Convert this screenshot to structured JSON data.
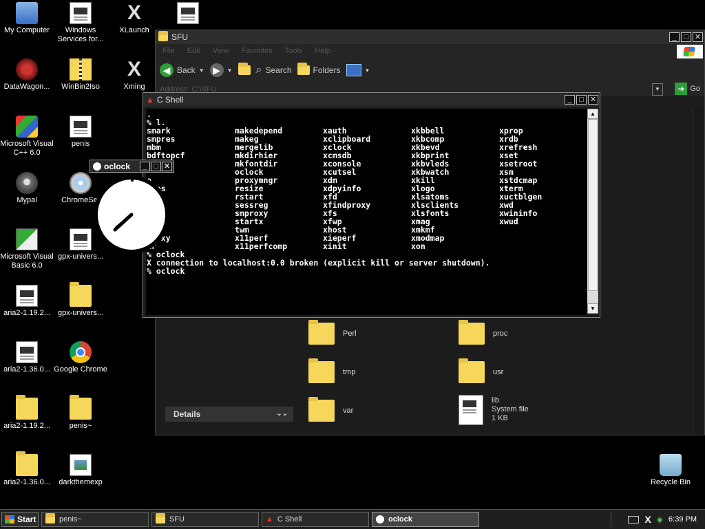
{
  "desktop": {
    "icons": [
      {
        "label": "My Computer",
        "icon": "computer-icon"
      },
      {
        "label": "Windows Services for...",
        "icon": "document-icon"
      },
      {
        "label": "XLaunch",
        "icon": "x-icon"
      },
      {
        "label": "",
        "icon": "document-icon"
      },
      {
        "label": "DataWagon...",
        "icon": "datawagon-icon"
      },
      {
        "label": "WinBin2Iso",
        "icon": "zip-icon"
      },
      {
        "label": "Xming",
        "icon": "x-icon"
      },
      {
        "label": "Microsoft Visual C++ 6.0",
        "icon": "visual-studio-icon"
      },
      {
        "label": "penis",
        "icon": "document-icon"
      },
      {
        "label": "Mypal",
        "icon": "mypal-icon"
      },
      {
        "label": "ChromeSet",
        "icon": "cd-icon"
      },
      {
        "label": "Microsoft Visual Basic 6.0",
        "icon": "visual-basic-icon"
      },
      {
        "label": "gpx-univers...",
        "icon": "document-icon"
      },
      {
        "label": "aria2-1.19.2...",
        "icon": "document-icon"
      },
      {
        "label": "gpx-univers...",
        "icon": "folder-icon"
      },
      {
        "label": "aria2-1.36.0...",
        "icon": "document-icon"
      },
      {
        "label": "Google Chrome",
        "icon": "chrome-icon"
      },
      {
        "label": "aria2-1.19.2...",
        "icon": "folder-icon"
      },
      {
        "label": "penis~",
        "icon": "folder-icon"
      },
      {
        "label": "aria2-1.36.0...",
        "icon": "folder-icon"
      },
      {
        "label": "darkthemexp",
        "icon": "image-icon"
      },
      {
        "label": "Recycle Bin",
        "icon": "recycle-bin-icon"
      }
    ]
  },
  "explorer": {
    "title": "SFU",
    "menu": [
      "File",
      "Edit",
      "View",
      "Favorites",
      "Tools",
      "Help"
    ],
    "toolbar": {
      "back": "Back",
      "search": "Search",
      "folders": "Folders"
    },
    "address_label": "Address",
    "address_value": "C:\\SFU",
    "go": "Go",
    "details": "Details",
    "items": [
      {
        "name": "Perl"
      },
      {
        "name": "proc"
      },
      {
        "name": "tmp"
      },
      {
        "name": "usr"
      },
      {
        "name": "var"
      },
      {
        "name": "lib",
        "type": "System file",
        "size": "1 KB"
      }
    ]
  },
  "cshell": {
    "title": "C Shell",
    "lines_top": [
      ".",
      "% l."
    ],
    "columns": [
      [
        "smark",
        "makedepend",
        "xauth",
        "xkbbell",
        "xprop"
      ],
      [
        "smpres",
        "makeg",
        "xclipboard",
        "xkbcomp",
        "xrdb"
      ],
      [
        "mbm",
        "mergelib",
        "xclock",
        "xkbevd",
        "xrefresh"
      ],
      [
        "bdftopcf",
        "mkdirhier",
        "xcmsdb",
        "xkbprint",
        "xset"
      ],
      [
        "dp",
        "mkfontdir",
        "xconsole",
        "xkbvleds",
        "xsetroot"
      ],
      [
        "",
        "oclock",
        "xcutsel",
        "xkbwatch",
        "xsm"
      ],
      [
        "e",
        "proxymngr",
        "xdm",
        "xkill",
        "xstdcmap"
      ],
      [
        "tres",
        "resize",
        "xdpyinfo",
        "xlogo",
        "xterm"
      ],
      [
        "fo",
        "rstart",
        "xfd",
        "xlsatoms",
        "xuctblgen"
      ],
      [
        "onts",
        "sessreg",
        "xfindproxy",
        "xlsclients",
        "xwd"
      ],
      [
        "df",
        "smproxy",
        "xfs",
        "xlsfonts",
        "xwininfo"
      ],
      [
        "th",
        "startx",
        "xfwp",
        "xmag",
        "xwud"
      ],
      [
        "",
        "twm",
        "xhost",
        "xmkmf",
        ""
      ],
      [
        "proxy",
        "x11perf",
        "xieperf",
        "xmodmap",
        ""
      ],
      [
        "ir",
        "x11perfcomp",
        "xinit",
        "xon",
        ""
      ]
    ],
    "lines_bottom": [
      "% oclock",
      "X connection to localhost:0.0 broken (explicit kill or server shutdown).",
      "% oclock"
    ]
  },
  "oclock": {
    "title": "oclock"
  },
  "taskbar": {
    "start": "Start",
    "tasks": [
      {
        "label": "penis~"
      },
      {
        "label": "SFU"
      },
      {
        "label": "C Shell"
      },
      {
        "label": "oclock"
      }
    ],
    "time": "6:39 PM"
  }
}
